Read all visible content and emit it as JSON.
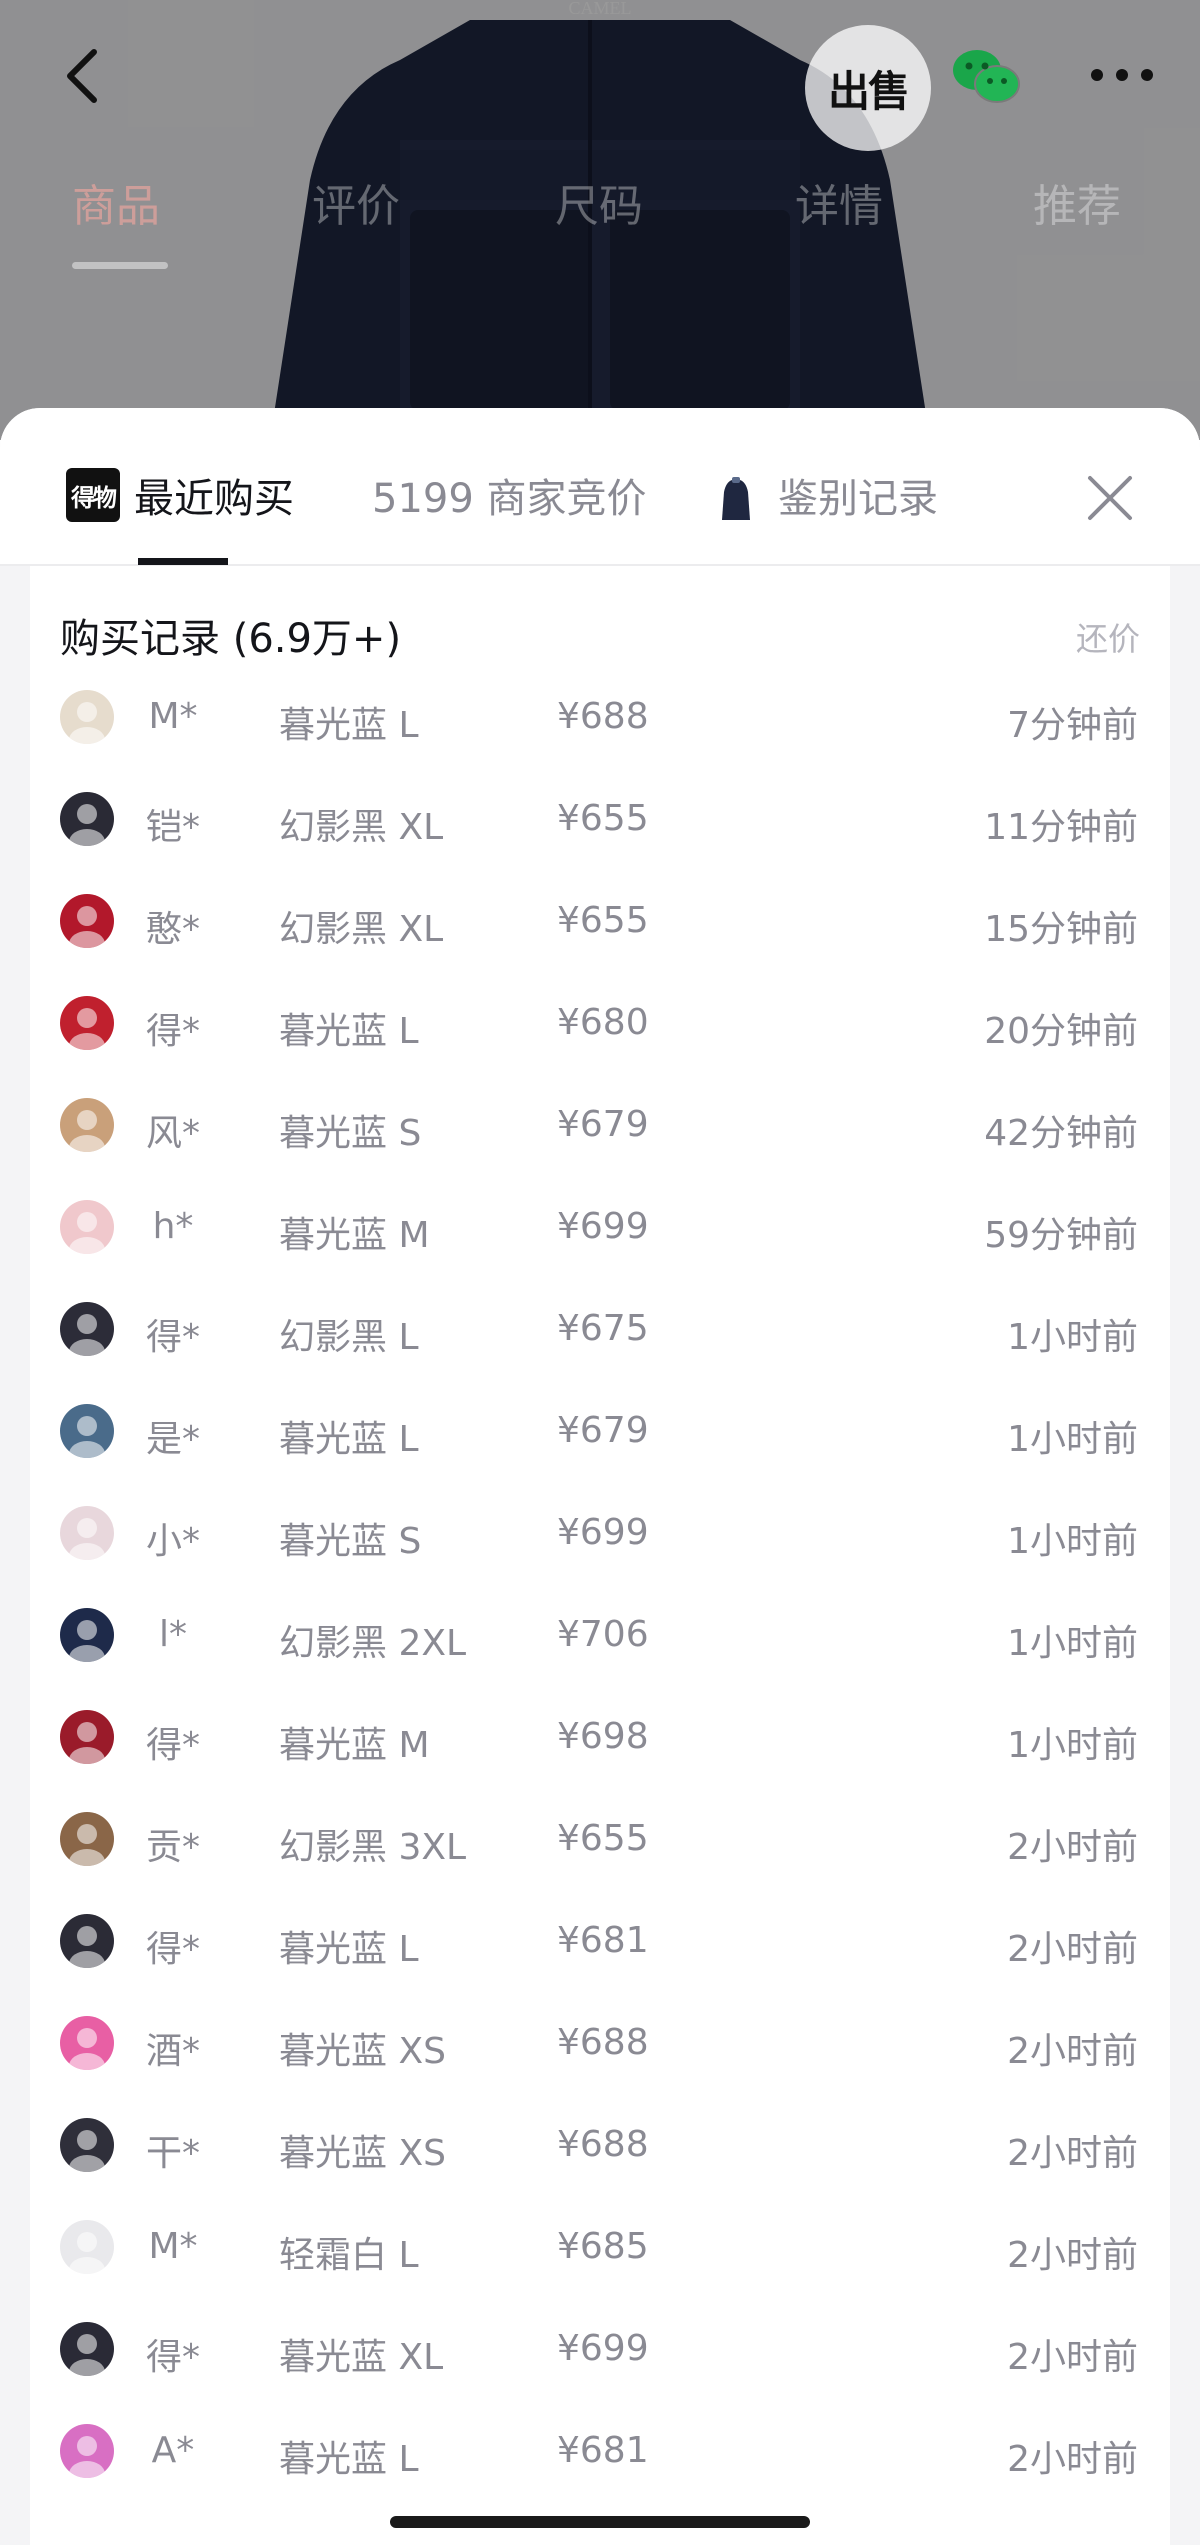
{
  "header": {
    "brand_on_jacket": "CAMEL",
    "sell_label": "出售",
    "icons": {
      "back": "back-arrow-icon",
      "wechat": "wechat-icon",
      "more": "more-icon"
    },
    "tabs": [
      "商品",
      "评价",
      "尺码",
      "详情",
      "推荐"
    ],
    "active_tab": "商品"
  },
  "sheet": {
    "logo_text": "得物",
    "tabs": [
      {
        "label": "最近购买",
        "active": true
      },
      {
        "label": "5199 商家竞价",
        "active": false
      },
      {
        "label": "鉴别记录",
        "active": false
      }
    ],
    "close_icon": "close-icon"
  },
  "records": {
    "title": "购买记录 (6.9万+)",
    "counter_offer": "还价",
    "rows": [
      {
        "name": "M*",
        "spec": "暮光蓝 L",
        "price": "¥688",
        "time": "7分钟前",
        "avatar_color": "#e6dccd"
      },
      {
        "name": "铠*",
        "spec": "幻影黑 XL",
        "price": "¥655",
        "time": "11分钟前",
        "avatar_color": "#2a2a35"
      },
      {
        "name": "憨*",
        "spec": "幻影黑 XL",
        "price": "¥655",
        "time": "15分钟前",
        "avatar_color": "#b2182b"
      },
      {
        "name": "得*",
        "spec": "暮光蓝 L",
        "price": "¥680",
        "time": "20分钟前",
        "avatar_color": "#c0202e"
      },
      {
        "name": "风*",
        "spec": "暮光蓝 S",
        "price": "¥679",
        "time": "42分钟前",
        "avatar_color": "#c9a07a"
      },
      {
        "name": "h*",
        "spec": "暮光蓝 M",
        "price": "¥699",
        "time": "59分钟前",
        "avatar_color": "#f0c8cc"
      },
      {
        "name": "得*",
        "spec": "幻影黑 L",
        "price": "¥675",
        "time": "1小时前",
        "avatar_color": "#2c2c38"
      },
      {
        "name": "是*",
        "spec": "暮光蓝 L",
        "price": "¥679",
        "time": "1小时前",
        "avatar_color": "#4a6b8a"
      },
      {
        "name": "小*",
        "spec": "暮光蓝 S",
        "price": "¥699",
        "time": "1小时前",
        "avatar_color": "#e8d7dc"
      },
      {
        "name": "l*",
        "spec": "幻影黑 2XL",
        "price": "¥706",
        "time": "1小时前",
        "avatar_color": "#1e2a4a"
      },
      {
        "name": "得*",
        "spec": "暮光蓝 M",
        "price": "¥698",
        "time": "1小时前",
        "avatar_color": "#9a1b2a"
      },
      {
        "name": "贡*",
        "spec": "幻影黑 3XL",
        "price": "¥655",
        "time": "2小时前",
        "avatar_color": "#8a6648"
      },
      {
        "name": "得*",
        "spec": "暮光蓝 L",
        "price": "¥681",
        "time": "2小时前",
        "avatar_color": "#2b2b36"
      },
      {
        "name": "酒*",
        "spec": "暮光蓝 XS",
        "price": "¥688",
        "time": "2小时前",
        "avatar_color": "#e85fa4"
      },
      {
        "name": "干*",
        "spec": "暮光蓝 XS",
        "price": "¥688",
        "time": "2小时前",
        "avatar_color": "#2f2f3a"
      },
      {
        "name": "M*",
        "spec": "轻霜白 L",
        "price": "¥685",
        "time": "2小时前",
        "avatar_color": "#e9e9ec"
      },
      {
        "name": "得*",
        "spec": "暮光蓝 XL",
        "price": "¥699",
        "time": "2小时前",
        "avatar_color": "#2a2a36"
      },
      {
        "name": "A*",
        "spec": "暮光蓝 L",
        "price": "¥681",
        "time": "2小时前",
        "avatar_color": "#d86fc3"
      }
    ]
  },
  "colors": {
    "text_primary": "#14151a",
    "text_secondary": "#8a8a93",
    "jacket": "#1f2740",
    "sheet_bg": "#f4f4f6"
  }
}
